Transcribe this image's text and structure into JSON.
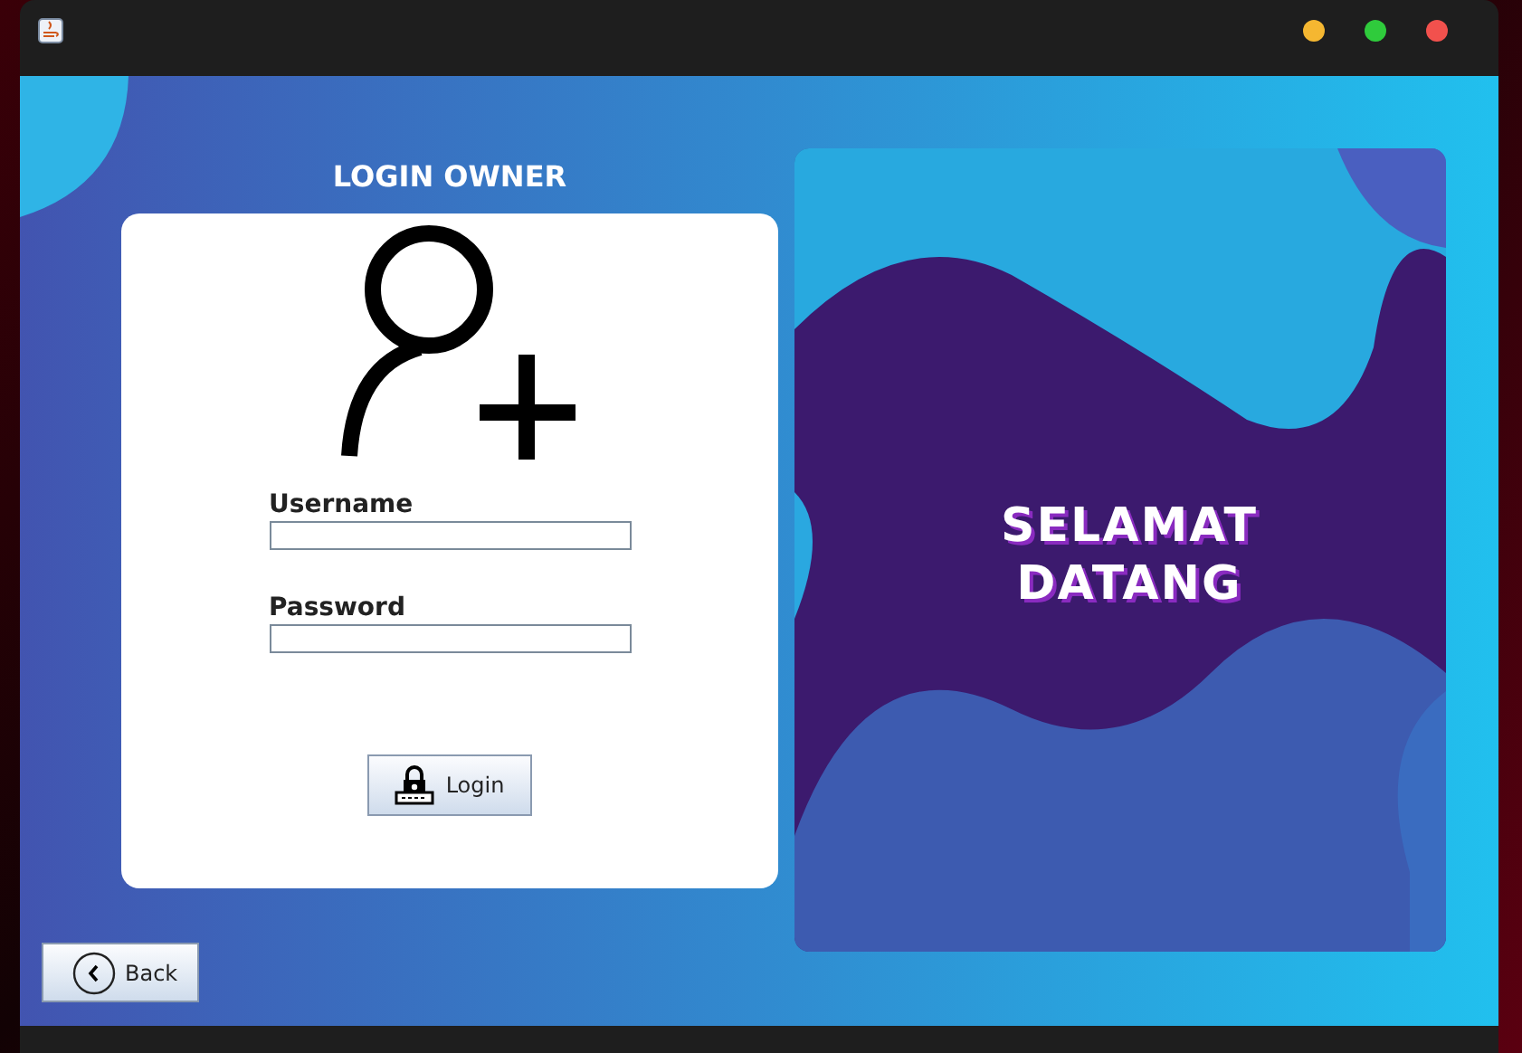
{
  "window": {
    "controls": [
      {
        "color": "#f5b731"
      },
      {
        "color": "#2fcb3c"
      },
      {
        "color": "#f2514d"
      }
    ]
  },
  "login": {
    "title": "LOGIN OWNER",
    "fields": [
      {
        "label": "Username"
      },
      {
        "label": "Password"
      }
    ],
    "button": "Login"
  },
  "banner": {
    "lines": [
      "SELAMAT",
      "DATANG"
    ]
  },
  "back_button": "Back"
}
